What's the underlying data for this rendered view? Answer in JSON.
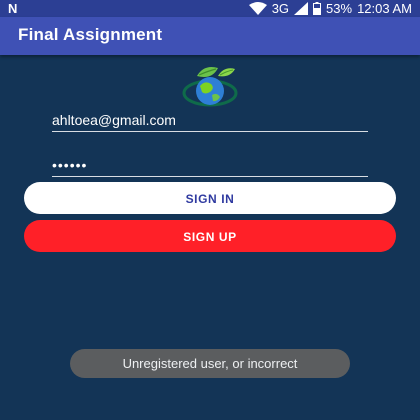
{
  "status_bar": {
    "left_icon": "N",
    "network": "3G",
    "battery": "53%",
    "time": "12:03 AM",
    "icons": [
      "wifi-icon",
      "signal-icon",
      "battery-icon"
    ]
  },
  "app_bar": {
    "title": "Final Assignment"
  },
  "logo": {
    "name": "earth-leaves-logo"
  },
  "form": {
    "email_value": "ahltoea@gmail.com",
    "password_value": "••••••"
  },
  "buttons": {
    "sign_in": "SIGN IN",
    "sign_up": "SIGN UP"
  },
  "toast": {
    "message": "Unregistered user, or incorrect"
  },
  "colors": {
    "background": "#133456",
    "app_bar": "#3f51b5",
    "status_bar": "#2c3f94",
    "sign_up": "#ff2028",
    "sign_in": "#ffffff"
  }
}
